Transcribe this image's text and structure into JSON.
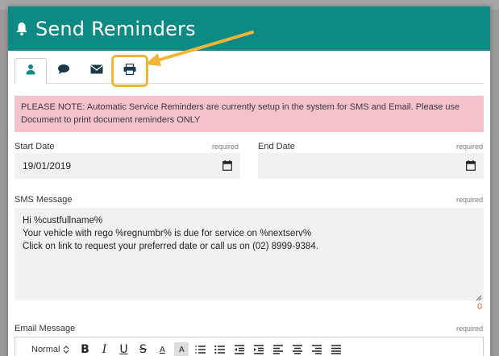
{
  "modal": {
    "title": "Send Reminders",
    "header_color": "#0d8a84",
    "title_icon": "bell-icon"
  },
  "tabs": [
    {
      "name": "person-icon",
      "active": true
    },
    {
      "name": "chat-bubble-icon",
      "active": false
    },
    {
      "name": "envelope-icon",
      "active": false
    },
    {
      "name": "printer-icon",
      "active": false
    }
  ],
  "annotation": {
    "highlight_color": "#f2b53a"
  },
  "notice": {
    "text": "PLEASE NOTE: Automatic Service Reminders are currently setup in the system for SMS and Email. Please use Document to print document reminders ONLY",
    "color": "#f4c2cb"
  },
  "form": {
    "start_date": {
      "label": "Start Date",
      "required": "required",
      "value": "19/01/2019"
    },
    "end_date": {
      "label": "End Date",
      "required": "required",
      "value": ""
    },
    "sms": {
      "label": "SMS Message",
      "required": "required",
      "lines": [
        "Hi %custfullname%",
        "Your vehicle with rego %regnumbr% is due for service on %nextserv%",
        "Click on link to request your preferred date or call us on (02) 8999-9384."
      ],
      "char_count": "0"
    },
    "email": {
      "label": "Email Message",
      "required": "required"
    }
  },
  "toolbar": {
    "format_select": "Normal",
    "buttons": [
      "B",
      "I",
      "U",
      "S",
      "A",
      "A"
    ]
  }
}
